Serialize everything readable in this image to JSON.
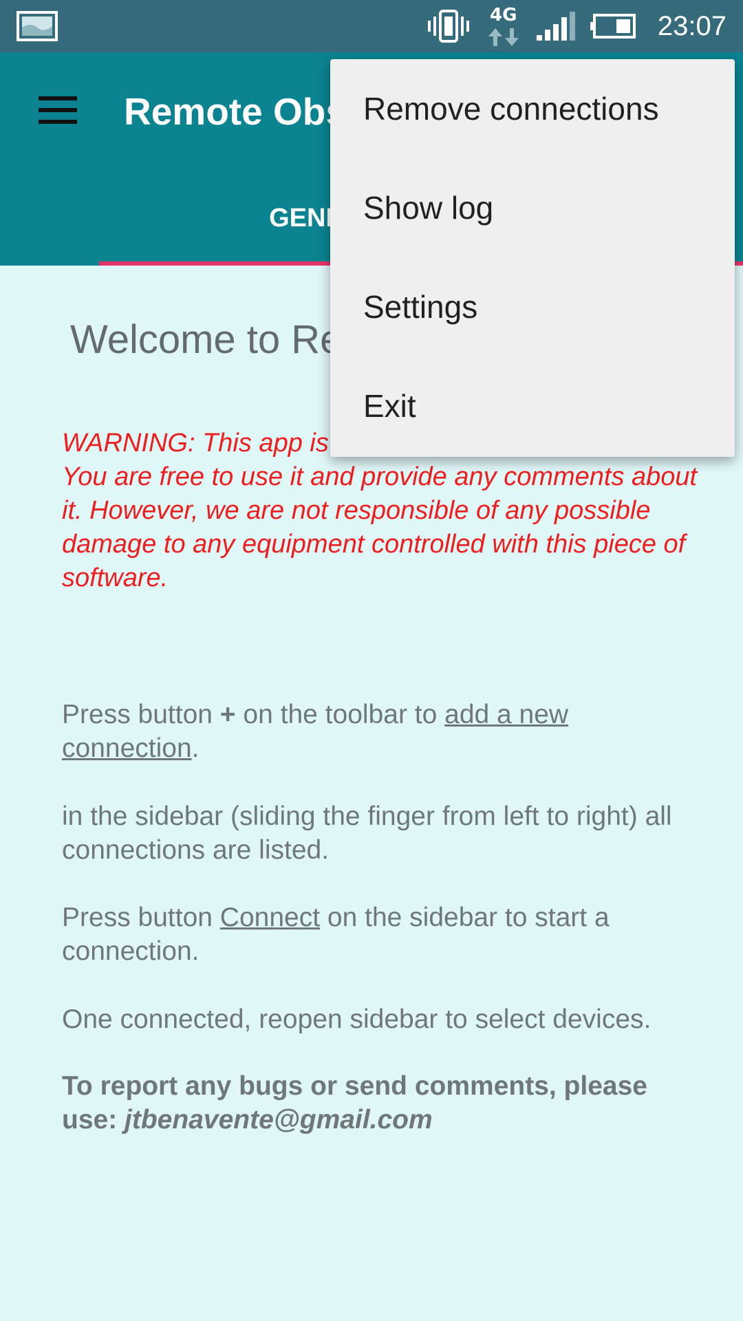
{
  "status_bar": {
    "time": "23:07",
    "network": "4G",
    "icons": [
      "gallery-icon",
      "vibrate-icon",
      "network-4g-icon",
      "signal-icon",
      "battery-icon"
    ]
  },
  "app_bar": {
    "title": "Remote Observatory",
    "tab_label": "GENERAL",
    "accent_color": "#0b8391",
    "indicator_color": "#e8336a"
  },
  "content": {
    "welcome": "Welcome to Remote Observatory",
    "warning": "WARNING: This app is currently in experimental phase. You are free to use it and provide any comments about it. However, we are not responsible of any possible damage to any equipment controlled with this piece of software.",
    "p1_pre": "Press button ",
    "p1_plus": "+",
    "p1_mid": " on the toolbar to ",
    "p1_link": "add a new connection",
    "p1_post": ".",
    "p2": "in the sidebar (sliding the finger from left to right) all connections are listed.",
    "p3_pre": "Press button ",
    "p3_link": "Connect",
    "p3_post": " on the sidebar to start a connection.",
    "p4": "One connected, reopen sidebar to select devices.",
    "p5_pre": "To report any bugs or send comments, please use: ",
    "p5_email": "jtbenavente@gmail.com"
  },
  "overflow_menu": {
    "items": [
      {
        "label": "Remove connections"
      },
      {
        "label": "Show log"
      },
      {
        "label": "Settings"
      },
      {
        "label": "Exit"
      }
    ]
  }
}
